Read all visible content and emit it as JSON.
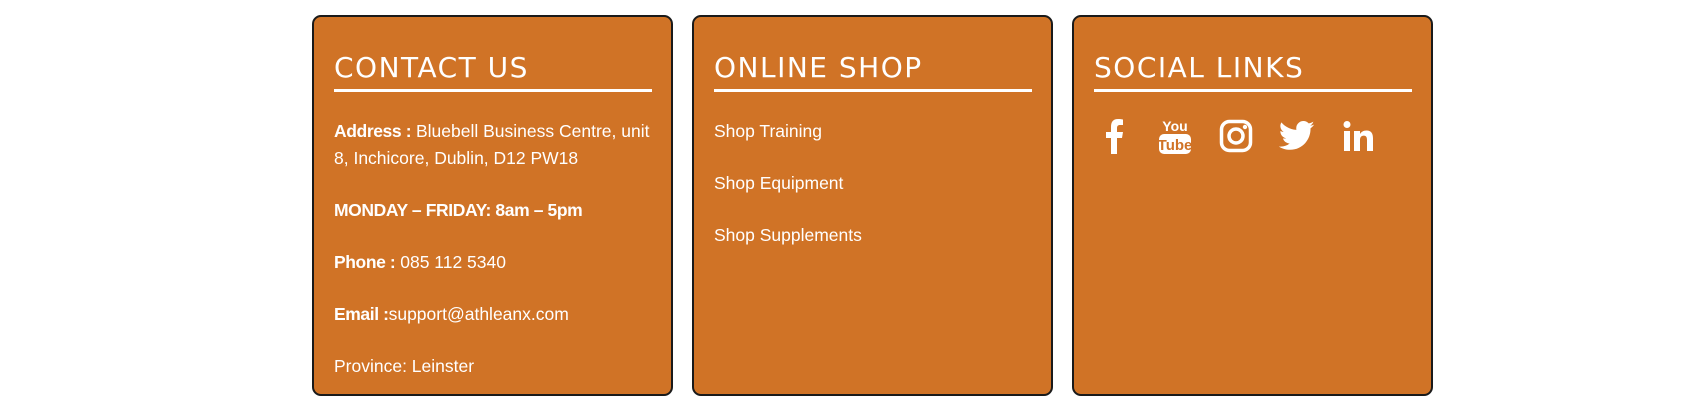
{
  "colors": {
    "card_background": "#d07326",
    "card_border": "#1a1a1a",
    "text": "#ffffff"
  },
  "contact": {
    "title": "CONTACT US",
    "address_label": "Address :",
    "address_value": " Bluebell Business Centre, unit 8, Inchicore, Dublin, D12 PW18",
    "hours": "MONDAY – FRIDAY: 8am – 5pm",
    "phone_label": "Phone :",
    "phone_value": " 085 112 5340",
    "email_label": "Email :",
    "email_value": "support@athleanx.com",
    "province": "Province: Leinster"
  },
  "shop": {
    "title": "ONLINE SHOP",
    "items": [
      {
        "label": "Shop Training"
      },
      {
        "label": "Shop Equipment"
      },
      {
        "label": "Shop Supplements"
      }
    ]
  },
  "social": {
    "title": "SOCIAL LINKS",
    "icons": [
      "facebook-icon",
      "youtube-icon",
      "instagram-icon",
      "twitter-icon",
      "linkedin-icon"
    ]
  }
}
